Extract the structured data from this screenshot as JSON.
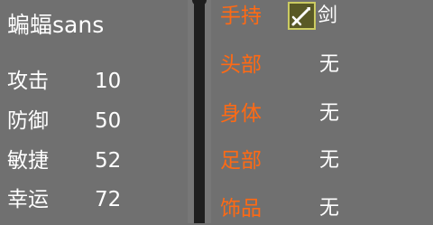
{
  "character": {
    "name": "蝙蝠sans"
  },
  "stats": [
    {
      "label": "攻击",
      "value": "10"
    },
    {
      "label": "防御",
      "value": "50"
    },
    {
      "label": "敏捷",
      "value": "52"
    },
    {
      "label": "幸运",
      "value": "72"
    }
  ],
  "equipment": [
    {
      "label": "手持",
      "value": "剑",
      "icon": "sword-icon"
    },
    {
      "label": "头部",
      "value": "无"
    },
    {
      "label": "身体",
      "value": "无"
    },
    {
      "label": "足部",
      "value": "无"
    },
    {
      "label": "饰品",
      "value": "无"
    }
  ],
  "colors": {
    "background": "#707070",
    "divider": "#1e1e1e",
    "slot_label": "#ff6a14",
    "text": "#ffffff",
    "icon_bg": "#595926",
    "icon_border": "#cbcb62"
  }
}
